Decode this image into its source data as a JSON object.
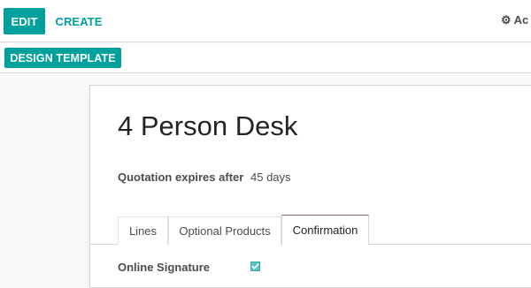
{
  "control_panel": {
    "edit_label": "EDIT",
    "create_label": "CREATE",
    "action_label": "Ac",
    "action_icon": "gear-icon"
  },
  "statusbar": {
    "design_template_label": "DESIGN TEMPLATE"
  },
  "record": {
    "title": "4 Person Desk",
    "quotation_expires_label": "Quotation expires after",
    "quotation_expires_value": "45 days"
  },
  "tabs": [
    {
      "label": "Lines",
      "active": false
    },
    {
      "label": "Optional Products",
      "active": false
    },
    {
      "label": "Confirmation",
      "active": true
    }
  ],
  "confirmation": {
    "online_signature_label": "Online Signature",
    "online_signature_checked": true
  },
  "colors": {
    "primary": "#00a09d",
    "active_tab_border": "#875a7b",
    "checkbox": "#5ec5c3"
  }
}
